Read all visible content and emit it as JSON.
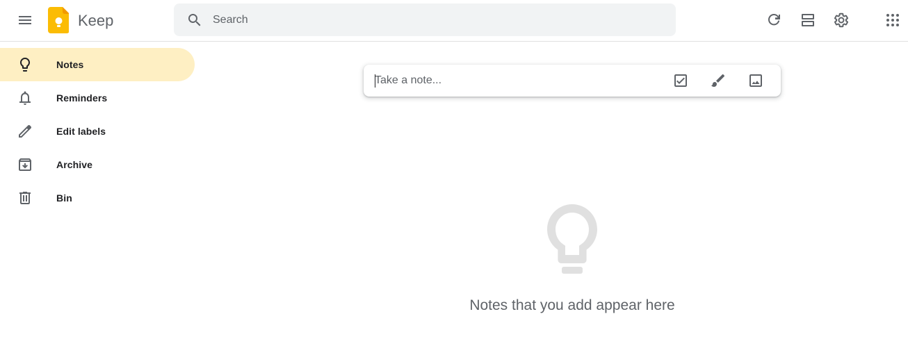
{
  "header": {
    "app_title": "Keep",
    "search_placeholder": "Search",
    "icons": {
      "menu": "hamburger-menu-icon",
      "logo": "keep-logo",
      "search": "search-icon",
      "refresh": "refresh-icon",
      "layout": "list-view-icon",
      "settings": "gear-icon",
      "apps": "apps-grid-icon"
    }
  },
  "sidebar": {
    "items": [
      {
        "label": "Notes",
        "icon": "lightbulb-icon",
        "active": true
      },
      {
        "label": "Reminders",
        "icon": "bell-icon",
        "active": false
      },
      {
        "label": "Edit labels",
        "icon": "pencil-icon",
        "active": false
      },
      {
        "label": "Archive",
        "icon": "archive-icon",
        "active": false
      },
      {
        "label": "Bin",
        "icon": "trash-icon",
        "active": false
      }
    ]
  },
  "note_composer": {
    "placeholder": "Take a note...",
    "tools": [
      "checkbox-icon",
      "brush-icon",
      "image-icon"
    ]
  },
  "empty_state": {
    "message": "Notes that you add appear here",
    "icon": "lightbulb-icon"
  },
  "colors": {
    "active_nav": "#feefc3",
    "search_bg": "#f1f3f4",
    "icon_gray": "#5f6368",
    "logo_yellow": "#fbbc04",
    "empty_icon": "#e0e0e0"
  }
}
